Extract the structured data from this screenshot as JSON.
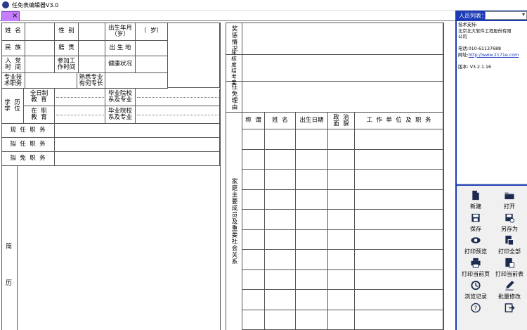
{
  "window": {
    "title": "任免表编辑器V3.0"
  },
  "tab": {
    "close": "×"
  },
  "form": {
    "name": "姓  名",
    "gender": "性  别",
    "birth": "出生年月\n（岁）",
    "age": "（  岁）",
    "ethnicity": "民  族",
    "origin": "籍  贯",
    "birthplace": "出 生 地",
    "party": "入  党\n时  间",
    "work": "参加工\n作时间",
    "health": "健康状况",
    "tech": "专业技\n术职务",
    "expertise": "熟悉专业\n有何专长",
    "edu": "学  历\n学  位",
    "fulltime": "全日制\n教  育",
    "inservice": "在  职\n教  育",
    "school1": "毕业院校\n系及专业",
    "school2": "毕业院校\n系及专业",
    "current": "现  任  职  务",
    "proposed": "拟  任  职  务",
    "remove": "拟  免  职  务",
    "resume1": "简",
    "resume2": "历",
    "reward": "奖惩情况",
    "annual": "年核度结考果",
    "reason": "任免理由",
    "family": "家庭主要成员及重要社会关系",
    "fam_title": "称  谓",
    "fam_name": "姓  名",
    "fam_birth": "出生日期",
    "fam_pol": "政  治\n面  貌",
    "fam_work": "工  作  单  位  及  职  务"
  },
  "panel": {
    "label": "人员列表：",
    "select_value": "",
    "info": [
      {
        "t": "技术支持:"
      },
      {
        "t": "    北京北大软件工程股份有限"
      },
      {
        "t": "公司"
      },
      {
        "t": ""
      },
      {
        "t": "电话:010-61137688"
      },
      {
        "t": "网址:"
      },
      {
        "t": ""
      },
      {
        "t": "版本: V3.2.1.16"
      }
    ],
    "url": "http://www.2171e.com"
  },
  "tools": [
    {
      "label": "新建",
      "icon": "new-icon"
    },
    {
      "label": "打开",
      "icon": "open-folder-icon"
    },
    {
      "label": "保存",
      "icon": "save-icon"
    },
    {
      "label": "另存为",
      "icon": "save-as-icon"
    },
    {
      "label": "打印预览",
      "icon": "eye-icon"
    },
    {
      "label": "打印全部",
      "icon": "print-all-icon"
    },
    {
      "label": "打印当前页",
      "icon": "printer-icon"
    },
    {
      "label": "打印当前表",
      "icon": "print-table-icon"
    },
    {
      "label": "浏览记录",
      "icon": "history-icon"
    },
    {
      "label": "批量修改",
      "icon": "edit-icon"
    },
    {
      "label": "",
      "icon": "help-icon"
    },
    {
      "label": "",
      "icon": "exit-icon"
    }
  ],
  "colors": {
    "accent": "#1c3bb5",
    "tab": "#c77dff"
  }
}
